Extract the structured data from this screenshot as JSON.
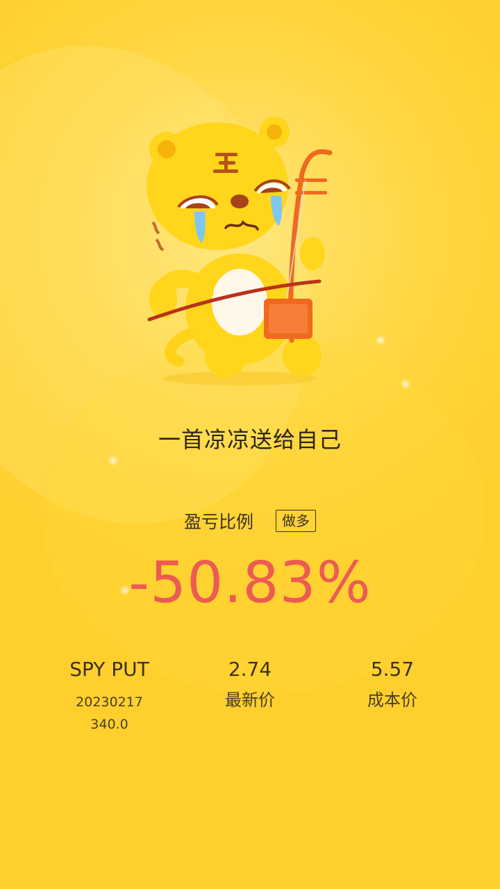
{
  "headline": "一首凉凉送给自己",
  "profit": {
    "label": "盈亏比例",
    "direction": "做多",
    "value": "-50.83%",
    "value_color": "#ec5b53"
  },
  "contract": {
    "name": "SPY PUT",
    "detail": "20230217 340.0"
  },
  "latest_price": {
    "value": "2.74",
    "label": "最新价"
  },
  "cost_price": {
    "value": "5.57",
    "label": "成本价"
  },
  "mascot": {
    "icon": "crying-tiger-playing-erhu-icon"
  },
  "colors": {
    "background": "#ffd235",
    "loss": "#ec5b53"
  }
}
